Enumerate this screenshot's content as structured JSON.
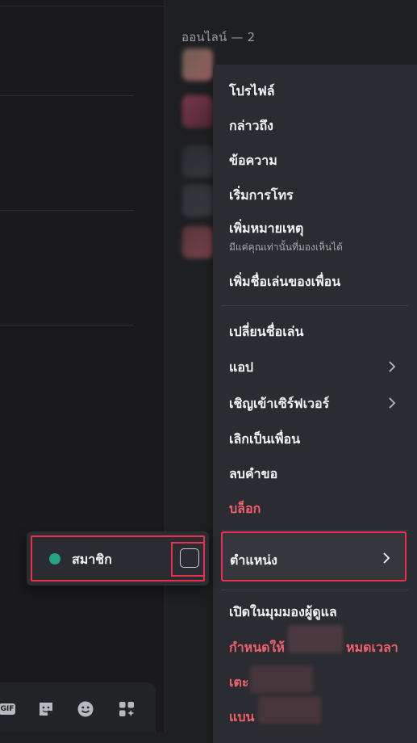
{
  "member_list": {
    "online_header": "ออนไลน์ — 2"
  },
  "context_menu": {
    "items": [
      {
        "label": "โปรไฟล์"
      },
      {
        "label": "กล่าวถึง"
      },
      {
        "label": "ข้อความ"
      },
      {
        "label": "เริ่มการโทร"
      },
      {
        "label": "เพิ่มหมายเหตุ",
        "sublabel": "มีแค่คุณเท่านั้นที่มองเห็นได้"
      },
      {
        "label": "เพิ่มชื่อเล่นของเพื่อน"
      },
      {
        "label": "เปลี่ยนชื่อเล่น"
      },
      {
        "label": "แอป"
      },
      {
        "label": "เชิญเข้าเซิร์ฟเวอร์"
      },
      {
        "label": "เลิกเป็นเพื่อน"
      },
      {
        "label": "ลบคำขอ"
      },
      {
        "label": "บล็อก"
      },
      {
        "label": "ตำแหน่ง"
      },
      {
        "label": "เปิดในมุมมองผู้ดูแล"
      },
      {
        "label": "กำหนดให้",
        "suffix": "หมดเวลา"
      },
      {
        "label": "เตะ"
      },
      {
        "label": "แบน"
      }
    ]
  },
  "role_submenu": {
    "role_name": "สมาชิก",
    "role_color": "#23a57f",
    "checked": false
  },
  "composer": {
    "gif_label": "GIF",
    "icons": [
      "sticker-icon",
      "emoji-icon",
      "apps-icon"
    ]
  },
  "colors": {
    "danger": "#f0616d",
    "highlight_border": "#e5334f"
  }
}
